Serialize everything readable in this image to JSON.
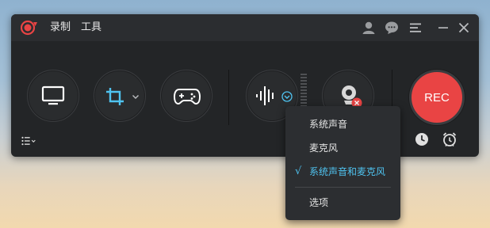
{
  "menu": {
    "record_label": "录制",
    "tools_label": "工具"
  },
  "colors": {
    "accent": "#4fc3f0",
    "rec": "#e94444",
    "window_bg": "#232527",
    "titlebar_bg": "#2b2d30"
  },
  "icons": {
    "logo": "app-logo-icon",
    "titlebar": [
      "user-icon",
      "chat-icon",
      "menu-icon",
      "minimize-icon",
      "close-icon"
    ],
    "modes": [
      "monitor-icon",
      "crop-icon",
      "gamepad-icon",
      "waveform-icon",
      "webcam-icon"
    ]
  },
  "record_button": {
    "label": "REC"
  },
  "audio_dropdown": {
    "items": [
      {
        "label": "系统声音",
        "selected": false
      },
      {
        "label": "麦克风",
        "selected": false
      },
      {
        "label": "系统声音和麦克风",
        "selected": true
      }
    ],
    "check_mark": "√",
    "options_label": "选项"
  }
}
